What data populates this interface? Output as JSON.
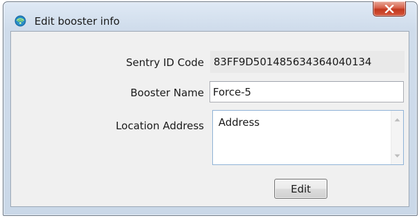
{
  "window": {
    "title": "Edit booster info",
    "icon": "wireless-signal-icon",
    "close_icon": "close-x-icon",
    "accent_color": "#c2391f"
  },
  "form": {
    "sentry_id": {
      "label": "Sentry ID Code",
      "value": "83FF9D501485634364040134"
    },
    "booster_name": {
      "label": "Booster Name",
      "value": "Force-5"
    },
    "location_address": {
      "label": "Location Address",
      "value": "Address"
    },
    "submit_label": "Edit"
  }
}
